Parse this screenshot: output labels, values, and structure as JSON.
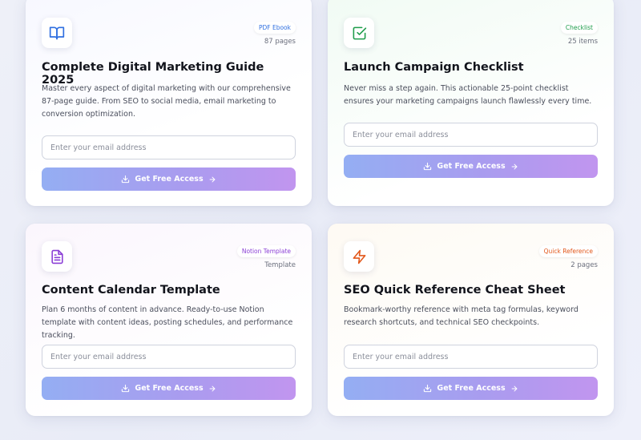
{
  "colors": {
    "ebook": "#2f6fe0",
    "checklist": "#1f9d4b",
    "template": "#8b3fd6",
    "reference": "#e2571a",
    "button_gradient_start": "#94aef3",
    "button_gradient_end": "#c195ef"
  },
  "cards": [
    {
      "icon": "book-open-icon",
      "badge": "PDF Ebook",
      "meta": "87 pages",
      "title": "Complete Digital Marketing Guide 2025",
      "description": "Master every aspect of digital marketing with our comprehensive 87-page guide. From SEO to social media, email marketing to conversion optimization.",
      "email_placeholder": "Enter your email address",
      "button_label": "Get Free Access"
    },
    {
      "icon": "check-square-icon",
      "badge": "Checklist",
      "meta": "25 items",
      "title": "Launch Campaign Checklist",
      "description": "Never miss a step again. This actionable 25-point checklist ensures your marketing campaigns launch flawlessly every time.",
      "email_placeholder": "Enter your email address",
      "button_label": "Get Free Access"
    },
    {
      "icon": "file-text-icon",
      "badge": "Notion Template",
      "meta": "Template",
      "title": "Content Calendar Template",
      "description": "Plan 6 months of content in advance. Ready-to-use Notion template with content ideas, posting schedules, and performance tracking.",
      "email_placeholder": "Enter your email address",
      "button_label": "Get Free Access"
    },
    {
      "icon": "lightning-icon",
      "badge": "Quick Reference",
      "meta": "2 pages",
      "title": "SEO Quick Reference Cheat Sheet",
      "description": "Bookmark-worthy reference with meta tag formulas, keyword research shortcuts, and technical SEO checkpoints.",
      "email_placeholder": "Enter your email address",
      "button_label": "Get Free Access"
    }
  ]
}
